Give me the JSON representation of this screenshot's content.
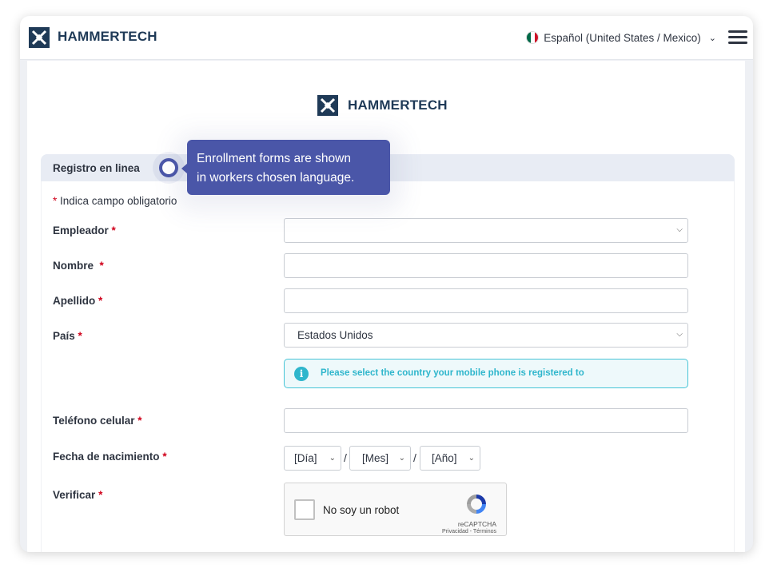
{
  "header": {
    "brand": "HAMMERTECH",
    "language": "Español (United States / Mexico)",
    "language_flag": "mexico-flag",
    "menu_icon": "hamburger-icon"
  },
  "main": {
    "brand": "HAMMERTECH",
    "section_title": "Registro en linea",
    "required_marker": "*",
    "required_note": "Indica campo obligatorio",
    "fields": {
      "employer": {
        "label": "Empleador",
        "value": ""
      },
      "first_name": {
        "label": "Nombre",
        "value": ""
      },
      "last_name": {
        "label": "Apellido",
        "value": ""
      },
      "country": {
        "label": "País",
        "value": "Estados Unidos"
      },
      "country_info": "Please select the country your mobile phone is registered to",
      "mobile": {
        "label": "Teléfono celular",
        "value": ""
      },
      "dob": {
        "label": "Fecha de nacimiento",
        "day": "[Día]",
        "month": "[Mes]",
        "year": "[Año]",
        "separator": "/"
      },
      "verify": {
        "label": "Verificar"
      }
    },
    "captcha": {
      "text": "No soy un robot",
      "brand": "reCAPTCHA",
      "terms": "Privacidad - Términos"
    }
  },
  "tooltip": {
    "line1": "Enrollment forms are shown",
    "line2": "in workers chosen language."
  },
  "colors": {
    "brand_navy": "#1f3a57",
    "tooltip": "#4a56a8",
    "required": "#d0021b",
    "info": "#2fb6cc"
  }
}
